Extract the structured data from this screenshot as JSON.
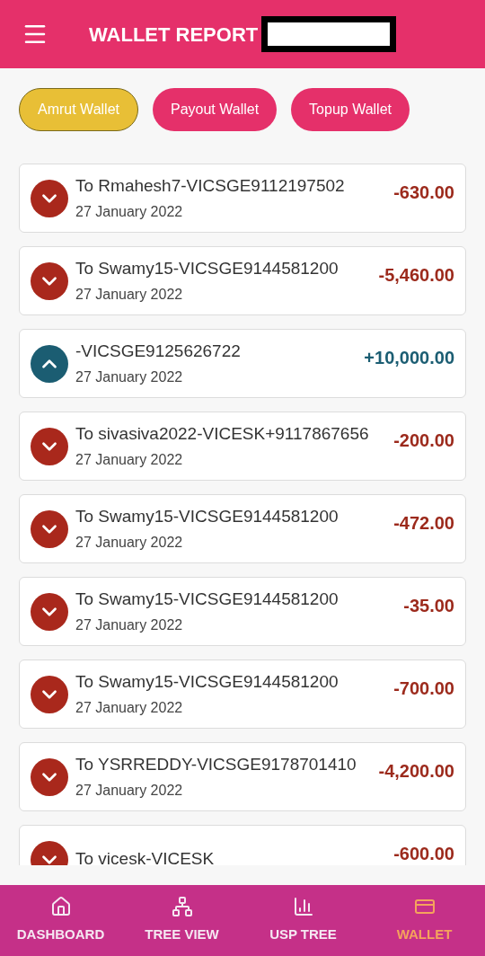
{
  "header": {
    "title": "WALLET REPORT"
  },
  "wallet_tabs": [
    {
      "label": "Amrut Wallet",
      "selected": true
    },
    {
      "label": "Payout Wallet",
      "selected": false
    },
    {
      "label": "Topup Wallet",
      "selected": false
    }
  ],
  "transactions": [
    {
      "kind": "debit",
      "description": "To Rmahesh7-VICSGE9112197502",
      "date": "27 January 2022",
      "amount": "-630.00"
    },
    {
      "kind": "debit",
      "description": "To Swamy15-VICSGE9144581200",
      "date": "27 January 2022",
      "amount": "-5,460.00"
    },
    {
      "kind": "credit",
      "description": "-VICSGE9125626722",
      "date": "27 January 2022",
      "amount": "+10,000.00"
    },
    {
      "kind": "debit",
      "description": "To sivasiva2022-VICESK+9117867656",
      "date": "27 January 2022",
      "amount": "-200.00"
    },
    {
      "kind": "debit",
      "description": "To Swamy15-VICSGE9144581200",
      "date": "27 January 2022",
      "amount": "-472.00"
    },
    {
      "kind": "debit",
      "description": "To Swamy15-VICSGE9144581200",
      "date": "27 January 2022",
      "amount": "-35.00"
    },
    {
      "kind": "debit",
      "description": "To Swamy15-VICSGE9144581200",
      "date": "27 January 2022",
      "amount": "-700.00"
    },
    {
      "kind": "debit",
      "description": "To YSRREDDY-VICSGE9178701410",
      "date": "27 January 2022",
      "amount": "-4,200.00"
    },
    {
      "kind": "debit",
      "description": "To vicesk-VICESK",
      "amount": "-600.00"
    }
  ],
  "bottom_nav": [
    {
      "kind": "home",
      "label": "DASHBOARD",
      "selected": false
    },
    {
      "kind": "tree",
      "label": "TREE VIEW",
      "selected": false
    },
    {
      "kind": "bars",
      "label": "USP TREE",
      "selected": false
    },
    {
      "kind": "wallet",
      "label": "WALLET",
      "selected": true
    }
  ]
}
